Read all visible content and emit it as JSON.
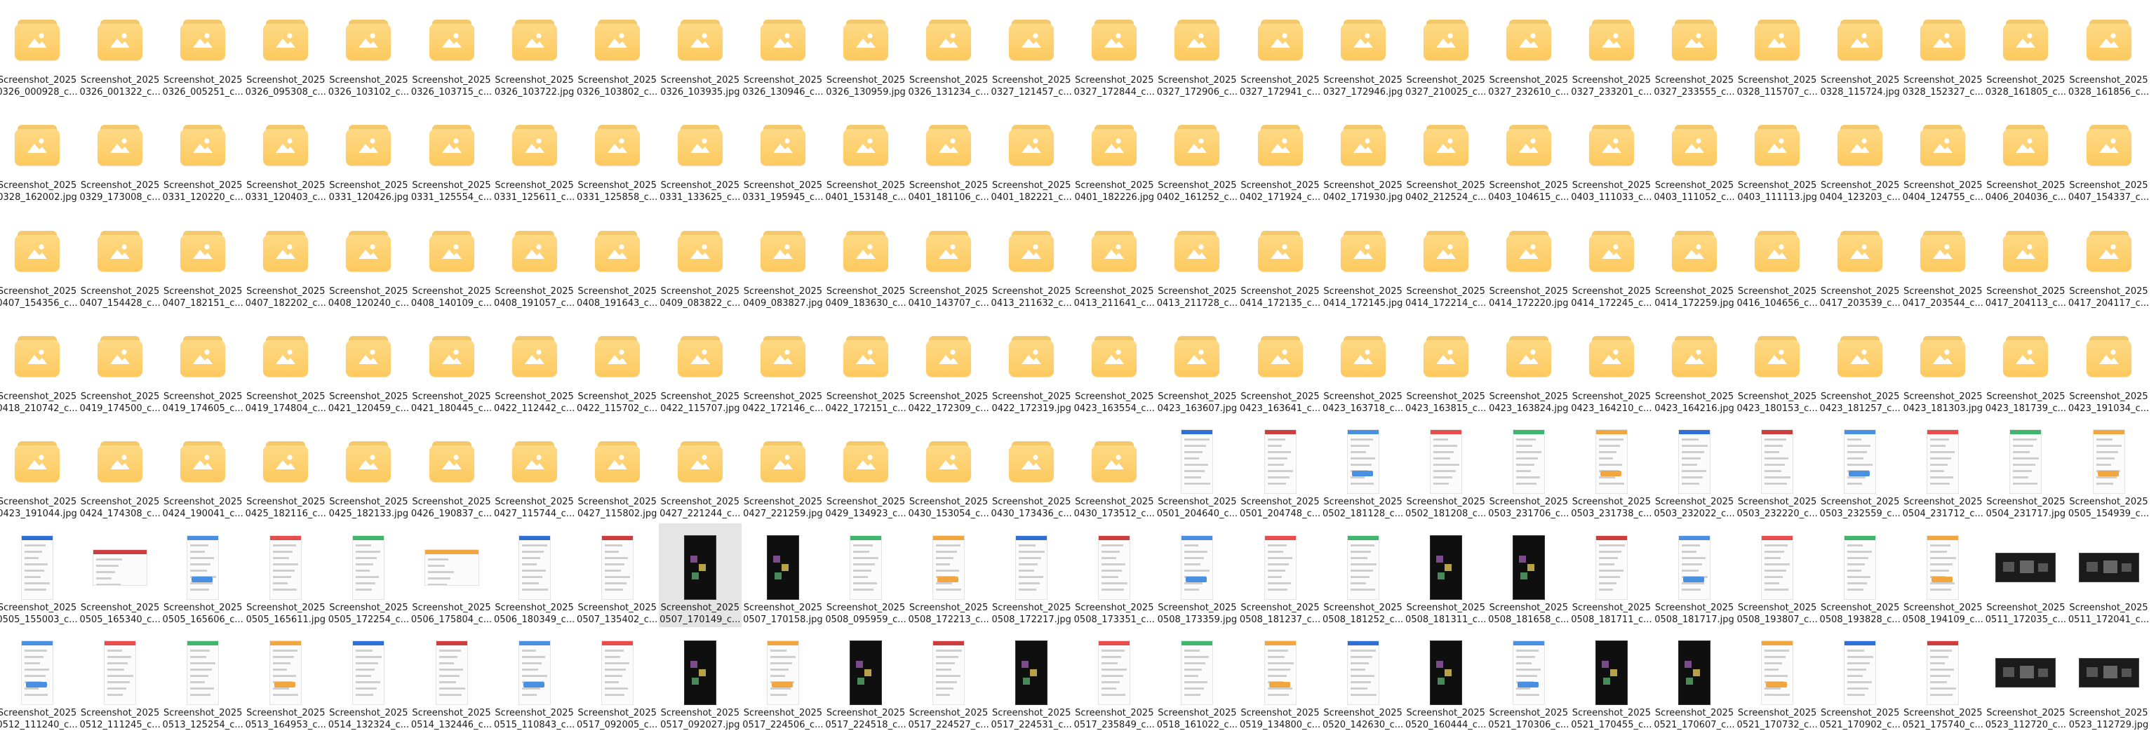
{
  "explorer": {
    "files": [
      [
        "Screenshot_2025",
        "0326_000928_c..."
      ],
      [
        "Screenshot_2025",
        "0326_001322_c..."
      ],
      [
        "Screenshot_2025",
        "0326_005251_c..."
      ],
      [
        "Screenshot_2025",
        "0326_095308_c..."
      ],
      [
        "Screenshot_2025",
        "0326_103102_c..."
      ],
      [
        "Screenshot_2025",
        "0326_103715_c..."
      ],
      [
        "Screenshot_2025",
        "0326_103722.jpg"
      ],
      [
        "Screenshot_2025",
        "0326_103802_c..."
      ],
      [
        "Screenshot_2025",
        "0326_103935.jpg"
      ],
      [
        "Screenshot_2025",
        "0326_130946_c..."
      ],
      [
        "Screenshot_2025",
        "0326_130959.jpg"
      ],
      [
        "Screenshot_2025",
        "0326_131234_c..."
      ],
      [
        "Screenshot_2025",
        "0327_121457_c..."
      ],
      [
        "Screenshot_2025",
        "0327_172844_c..."
      ],
      [
        "Screenshot_2025",
        "0327_172906_c..."
      ],
      [
        "Screenshot_2025",
        "0327_172941_c..."
      ],
      [
        "Screenshot_2025",
        "0327_172946.jpg"
      ],
      [
        "Screenshot_2025",
        "0327_210025_c..."
      ],
      [
        "Screenshot_2025",
        "0327_232610_c..."
      ],
      [
        "Screenshot_2025",
        "0327_233201_c..."
      ],
      [
        "Screenshot_2025",
        "0327_233555_c..."
      ],
      [
        "Screenshot_2025",
        "0328_115707_c..."
      ],
      [
        "Screenshot_2025",
        "0328_115724.jpg"
      ],
      [
        "Screenshot_2025",
        "0328_152327_c..."
      ],
      [
        "Screenshot_2025",
        "0328_161805_c..."
      ],
      [
        "Screenshot_2025",
        "0328_161856_c..."
      ],
      [
        "Screenshot_2025",
        "0328_162002.jpg"
      ],
      [
        "Screenshot_2025",
        "0329_173008_c..."
      ],
      [
        "Screenshot_2025",
        "0331_120220_c..."
      ],
      [
        "Screenshot_2025",
        "0331_120403_c..."
      ],
      [
        "Screenshot_2025",
        "0331_120426.jpg"
      ],
      [
        "Screenshot_2025",
        "0331_125554_c..."
      ],
      [
        "Screenshot_2025",
        "0331_125611_c..."
      ],
      [
        "Screenshot_2025",
        "0331_125858_c..."
      ],
      [
        "Screenshot_2025",
        "0331_133625_c..."
      ],
      [
        "Screenshot_2025",
        "0331_195945_c..."
      ],
      [
        "Screenshot_2025",
        "0401_153148_c..."
      ],
      [
        "Screenshot_2025",
        "0401_181106_c..."
      ],
      [
        "Screenshot_2025",
        "0401_182221_c..."
      ],
      [
        "Screenshot_2025",
        "0401_182226.jpg"
      ],
      [
        "Screenshot_2025",
        "0402_161252_c..."
      ],
      [
        "Screenshot_2025",
        "0402_171924_c..."
      ],
      [
        "Screenshot_2025",
        "0402_171930.jpg"
      ],
      [
        "Screenshot_2025",
        "0402_212524_c..."
      ],
      [
        "Screenshot_2025",
        "0403_104615_c..."
      ],
      [
        "Screenshot_2025",
        "0403_111033_c..."
      ],
      [
        "Screenshot_2025",
        "0403_111052_c..."
      ],
      [
        "Screenshot_2025",
        "0403_111113.jpg"
      ],
      [
        "Screenshot_2025",
        "0404_123203_c..."
      ],
      [
        "Screenshot_2025",
        "0404_124755_c..."
      ],
      [
        "Screenshot_2025",
        "0406_204036_c..."
      ],
      [
        "Screenshot_2025",
        "0407_154337_c..."
      ],
      [
        "Screenshot_2025",
        "0407_154356_c..."
      ],
      [
        "Screenshot_2025",
        "0407_154428_c..."
      ],
      [
        "Screenshot_2025",
        "0407_182151_c..."
      ],
      [
        "Screenshot_2025",
        "0407_182202_c..."
      ],
      [
        "Screenshot_2025",
        "0408_120240_c..."
      ],
      [
        "Screenshot_2025",
        "0408_140109_c..."
      ],
      [
        "Screenshot_2025",
        "0408_191057_c..."
      ],
      [
        "Screenshot_2025",
        "0408_191643_c..."
      ],
      [
        "Screenshot_2025",
        "0409_083822_c..."
      ],
      [
        "Screenshot_2025",
        "0409_083827.jpg"
      ],
      [
        "Screenshot_2025",
        "0409_183630_c..."
      ],
      [
        "Screenshot_2025",
        "0410_143707_c..."
      ],
      [
        "Screenshot_2025",
        "0413_211632_c..."
      ],
      [
        "Screenshot_2025",
        "0413_211641_c..."
      ],
      [
        "Screenshot_2025",
        "0413_211728_c..."
      ],
      [
        "Screenshot_2025",
        "0414_172135_c..."
      ],
      [
        "Screenshot_2025",
        "0414_172145.jpg"
      ],
      [
        "Screenshot_2025",
        "0414_172214_c..."
      ],
      [
        "Screenshot_2025",
        "0414_172220.jpg"
      ],
      [
        "Screenshot_2025",
        "0414_172245_c..."
      ],
      [
        "Screenshot_2025",
        "0414_172259.jpg"
      ],
      [
        "Screenshot_2025",
        "0416_104656_c..."
      ],
      [
        "Screenshot_2025",
        "0417_203539_c..."
      ],
      [
        "Screenshot_2025",
        "0417_203544_c..."
      ],
      [
        "Screenshot_2025",
        "0417_204113_c..."
      ],
      [
        "Screenshot_2025",
        "0417_204117_c..."
      ],
      [
        "Screenshot_2025",
        "0418_210742_c..."
      ],
      [
        "Screenshot_2025",
        "0419_174500_c..."
      ],
      [
        "Screenshot_2025",
        "0419_174605_c..."
      ],
      [
        "Screenshot_2025",
        "0419_174804_c..."
      ],
      [
        "Screenshot_2025",
        "0421_120459_c..."
      ],
      [
        "Screenshot_2025",
        "0421_180445_c..."
      ],
      [
        "Screenshot_2025",
        "0422_112442_c..."
      ],
      [
        "Screenshot_2025",
        "0422_115702_c..."
      ],
      [
        "Screenshot_2025",
        "0422_115707.jpg"
      ],
      [
        "Screenshot_2025",
        "0422_172146_c..."
      ],
      [
        "Screenshot_2025",
        "0422_172151_c..."
      ],
      [
        "Screenshot_2025",
        "0422_172309_c..."
      ],
      [
        "Screenshot_2025",
        "0422_172319.jpg"
      ],
      [
        "Screenshot_2025",
        "0423_163554_c..."
      ],
      [
        "Screenshot_2025",
        "0423_163607.jpg"
      ],
      [
        "Screenshot_2025",
        "0423_163641_c..."
      ],
      [
        "Screenshot_2025",
        "0423_163718_c..."
      ],
      [
        "Screenshot_2025",
        "0423_163815_c..."
      ],
      [
        "Screenshot_2025",
        "0423_163824.jpg"
      ],
      [
        "Screenshot_2025",
        "0423_164210_c..."
      ],
      [
        "Screenshot_2025",
        "0423_164216.jpg"
      ],
      [
        "Screenshot_2025",
        "0423_180153_c..."
      ],
      [
        "Screenshot_2025",
        "0423_181257_c..."
      ],
      [
        "Screenshot_2025",
        "0423_181303.jpg"
      ],
      [
        "Screenshot_2025",
        "0423_181739_c..."
      ],
      [
        "Screenshot_2025",
        "0423_191034_c..."
      ],
      [
        "Screenshot_2025",
        "0423_191044.jpg"
      ],
      [
        "Screenshot_2025",
        "0424_174308_c..."
      ],
      [
        "Screenshot_2025",
        "0424_190041_c..."
      ],
      [
        "Screenshot_2025",
        "0425_182116_c..."
      ],
      [
        "Screenshot_2025",
        "0425_182133.jpg"
      ],
      [
        "Screenshot_2025",
        "0426_190837_c..."
      ],
      [
        "Screenshot_2025",
        "0427_115744_c..."
      ],
      [
        "Screenshot_2025",
        "0427_115802.jpg"
      ],
      [
        "Screenshot_2025",
        "0427_221244_c..."
      ],
      [
        "Screenshot_2025",
        "0427_221259.jpg"
      ],
      [
        "Screenshot_2025",
        "0429_134923_c..."
      ],
      [
        "Screenshot_2025",
        "0430_153054_c..."
      ],
      [
        "Screenshot_2025",
        "0430_173436_c..."
      ],
      [
        "Screenshot_2025",
        "0430_173512_c..."
      ],
      [
        "Screenshot_2025",
        "0501_204640_c..."
      ],
      [
        "Screenshot_2025",
        "0501_204748_c..."
      ],
      [
        "Screenshot_2025",
        "0502_181128_c..."
      ],
      [
        "Screenshot_2025",
        "0502_181208_c..."
      ],
      [
        "Screenshot_2025",
        "0503_231706_c..."
      ],
      [
        "Screenshot_2025",
        "0503_231738_c..."
      ],
      [
        "Screenshot_2025",
        "0503_232022_c..."
      ],
      [
        "Screenshot_2025",
        "0503_232220_c..."
      ],
      [
        "Screenshot_2025",
        "0503_232559_c..."
      ],
      [
        "Screenshot_2025",
        "0504_231712_c..."
      ],
      [
        "Screenshot_2025",
        "0504_231717.jpg"
      ],
      [
        "Screenshot_2025",
        "0505_154939_c..."
      ],
      [
        "Screenshot_2025",
        "0505_155003_c..."
      ],
      [
        "Screenshot_2025",
        "0505_165340_c..."
      ],
      [
        "Screenshot_2025",
        "0505_165606_c..."
      ],
      [
        "Screenshot_2025",
        "0505_165611.jpg"
      ],
      [
        "Screenshot_2025",
        "0505_172254_c..."
      ],
      [
        "Screenshot_2025",
        "0506_175804_c..."
      ],
      [
        "Screenshot_2025",
        "0506_180349_c..."
      ],
      [
        "Screenshot_2025",
        "0507_135402_c..."
      ],
      [
        "Screenshot_2025",
        "0507_170149_c..."
      ],
      [
        "Screenshot_2025",
        "0507_170158.jpg"
      ],
      [
        "Screenshot_2025",
        "0508_095959_c..."
      ],
      [
        "Screenshot_2025",
        "0508_172213_c..."
      ],
      [
        "Screenshot_2025",
        "0508_172217.jpg"
      ],
      [
        "Screenshot_2025",
        "0508_173351_c..."
      ],
      [
        "Screenshot_2025",
        "0508_173359.jpg"
      ],
      [
        "Screenshot_2025",
        "0508_181237_c..."
      ],
      [
        "Screenshot_2025",
        "0508_181252_c..."
      ],
      [
        "Screenshot_2025",
        "0508_181311_c..."
      ],
      [
        "Screenshot_2025",
        "0508_181658_c..."
      ],
      [
        "Screenshot_2025",
        "0508_181711_c..."
      ],
      [
        "Screenshot_2025",
        "0508_181717.jpg"
      ],
      [
        "Screenshot_2025",
        "0508_193807_c..."
      ],
      [
        "Screenshot_2025",
        "0508_193828_c..."
      ],
      [
        "Screenshot_2025",
        "0508_194109_c..."
      ],
      [
        "Screenshot_2025",
        "0511_172035_c..."
      ],
      [
        "Screenshot_2025",
        "0511_172041_c..."
      ],
      [
        "Screenshot_2025",
        "0512_111240_c..."
      ],
      [
        "Screenshot_2025",
        "0512_111245_c..."
      ],
      [
        "Screenshot_2025",
        "0513_125254_c..."
      ],
      [
        "Screenshot_2025",
        "0513_164953_c..."
      ],
      [
        "Screenshot_2025",
        "0514_132324_c..."
      ],
      [
        "Screenshot_2025",
        "0514_132446_c..."
      ],
      [
        "Screenshot_2025",
        "0515_110843_c..."
      ],
      [
        "Screenshot_2025",
        "0517_092005_c..."
      ],
      [
        "Screenshot_2025",
        "0517_092027.jpg"
      ],
      [
        "Screenshot_2025",
        "0517_224506_c..."
      ],
      [
        "Screenshot_2025",
        "0517_224518_c..."
      ],
      [
        "Screenshot_2025",
        "0517_224527_c..."
      ],
      [
        "Screenshot_2025",
        "0517_224531_c..."
      ],
      [
        "Screenshot_2025",
        "0517_235849_c..."
      ],
      [
        "Screenshot_2025",
        "0518_161022_c..."
      ],
      [
        "Screenshot_2025",
        "0519_134800_c..."
      ],
      [
        "Screenshot_2025",
        "0520_142630_c..."
      ],
      [
        "Screenshot_2025",
        "0520_160444_c..."
      ],
      [
        "Screenshot_2025",
        "0521_170306_c..."
      ],
      [
        "Screenshot_2025",
        "0521_170455_c..."
      ],
      [
        "Screenshot_2025",
        "0521_170607_c..."
      ],
      [
        "Screenshot_2025",
        "0521_170732_c..."
      ],
      [
        "Screenshot_2025",
        "0521_170902_c..."
      ],
      [
        "Screenshot_2025",
        "0521_175740_c..."
      ],
      [
        "Screenshot_2025",
        "0523_112720_c..."
      ],
      [
        "Screenshot_2025",
        "0523_112729.jpg"
      ]
    ],
    "selected_index": 138,
    "placeholder_color": "#fcc95e",
    "selection_color": "#e5e5e5"
  }
}
